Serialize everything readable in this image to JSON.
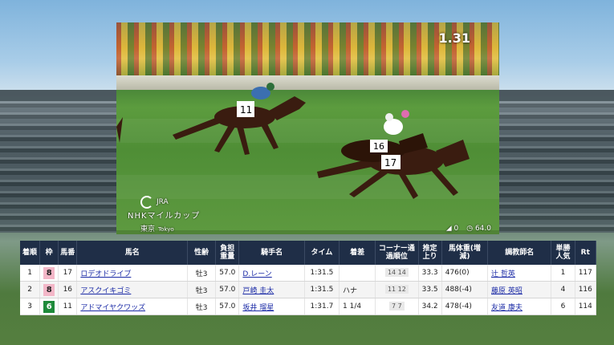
{
  "video": {
    "time": "1.31",
    "broadcaster": "JRA",
    "race_name": "NHKマイルカップ",
    "venue": "東京",
    "venue_en": "Tokyo",
    "wind_value": "0",
    "speed": "64.0"
  },
  "table": {
    "headers": {
      "rank": "着順",
      "waku": "枠",
      "umaban": "馬番",
      "horse": "馬名",
      "sex_age": "性齢",
      "weight": "負担重量",
      "jockey": "騎手名",
      "time": "タイム",
      "margin": "着差",
      "corner": "コーナー通過順位",
      "last3f": "推定上り",
      "body_weight": "馬体重(増減)",
      "trainer": "調教師名",
      "popularity": "単勝人気",
      "rating": "Rt"
    },
    "rows": [
      {
        "rank": "1",
        "waku": "8",
        "waku_bg": "#f3b7c8",
        "waku_fg": "#222222",
        "umaban": "17",
        "horse": "ロデオドライブ",
        "sex_age": "牡3",
        "weight": "57.0",
        "jockey": "D.レーン",
        "time": "1:31.5",
        "margin": "",
        "corner": "14 14",
        "last3f": "33.3",
        "body_weight": "476(0)",
        "trainer": "辻 哲英",
        "popularity": "1",
        "rating": "117"
      },
      {
        "rank": "2",
        "waku": "8",
        "waku_bg": "#f3b7c8",
        "waku_fg": "#222222",
        "umaban": "16",
        "horse": "アスクイキゴミ",
        "sex_age": "牡3",
        "weight": "57.0",
        "jockey": "戸崎 圭太",
        "time": "1:31.5",
        "margin": "ハナ",
        "corner": "11 12",
        "last3f": "33.5",
        "body_weight": "488(-4)",
        "trainer": "藤原 英昭",
        "popularity": "4",
        "rating": "116"
      },
      {
        "rank": "3",
        "waku": "6",
        "waku_bg": "#1e8a3a",
        "waku_fg": "#ffffff",
        "umaban": "11",
        "horse": "アドマイヤクワッズ",
        "sex_age": "牡3",
        "weight": "57.0",
        "jockey": "坂井 瑠星",
        "time": "1:31.7",
        "margin": "1 1/4",
        "corner": "7 7",
        "last3f": "34.2",
        "body_weight": "478(-4)",
        "trainer": "友道 康夫",
        "popularity": "6",
        "rating": "114"
      }
    ]
  }
}
